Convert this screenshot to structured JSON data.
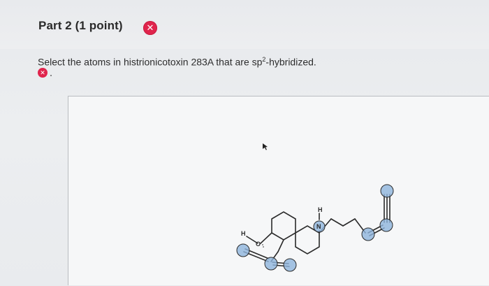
{
  "header": {
    "part_title": "Part 2 (1 point)",
    "status_icon": "error-x-icon",
    "status_color": "#e0244c"
  },
  "question": {
    "prompt_before_sup": "Select the atoms in histrionicotoxin 283A that are sp",
    "prompt_sup": "2",
    "prompt_after_sup": "-hybridized.",
    "answer_status_icon": "error-x-icon"
  },
  "molecule": {
    "atom_labels": {
      "oh_h": "H",
      "oxygen": "O",
      "nh_h": "H",
      "nitrogen": "N"
    },
    "selected_atom_color": "#8fb4dc",
    "bond_color": "#2a2a2a"
  },
  "canvas": {
    "cursor_icon": "arrow-cursor-icon"
  }
}
